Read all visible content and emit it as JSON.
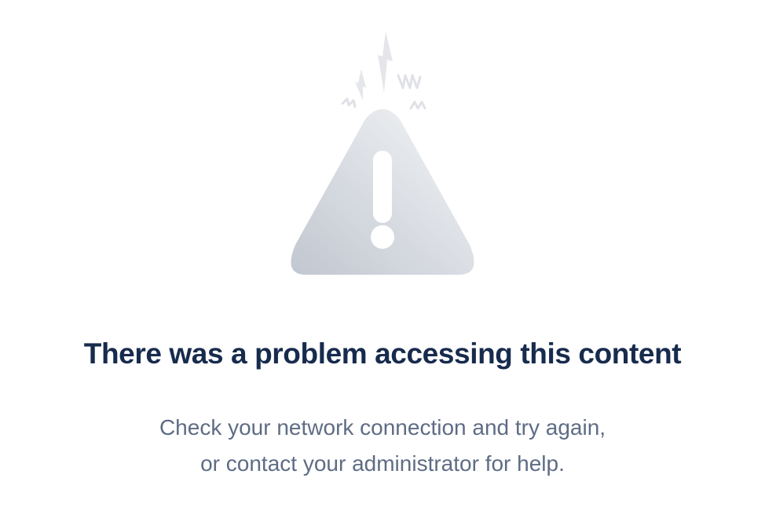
{
  "illustration": {
    "icon": "warning-triangle-icon",
    "accent_icons": [
      "lightning-bolt-icon",
      "squiggle-icon"
    ],
    "colors": {
      "triangle_light": "#EEEFF2",
      "triangle_dark": "#C5C9D3",
      "mark": "#FFFFFF",
      "sparks": "#DFE1E6"
    }
  },
  "error": {
    "title": "There was a problem accessing this content",
    "message_line1": "Check your network connection and try again,",
    "message_line2": "or contact your administrator for help."
  },
  "colors": {
    "title": "#172B4D",
    "message": "#5E6C84",
    "background": "#FFFFFF"
  }
}
